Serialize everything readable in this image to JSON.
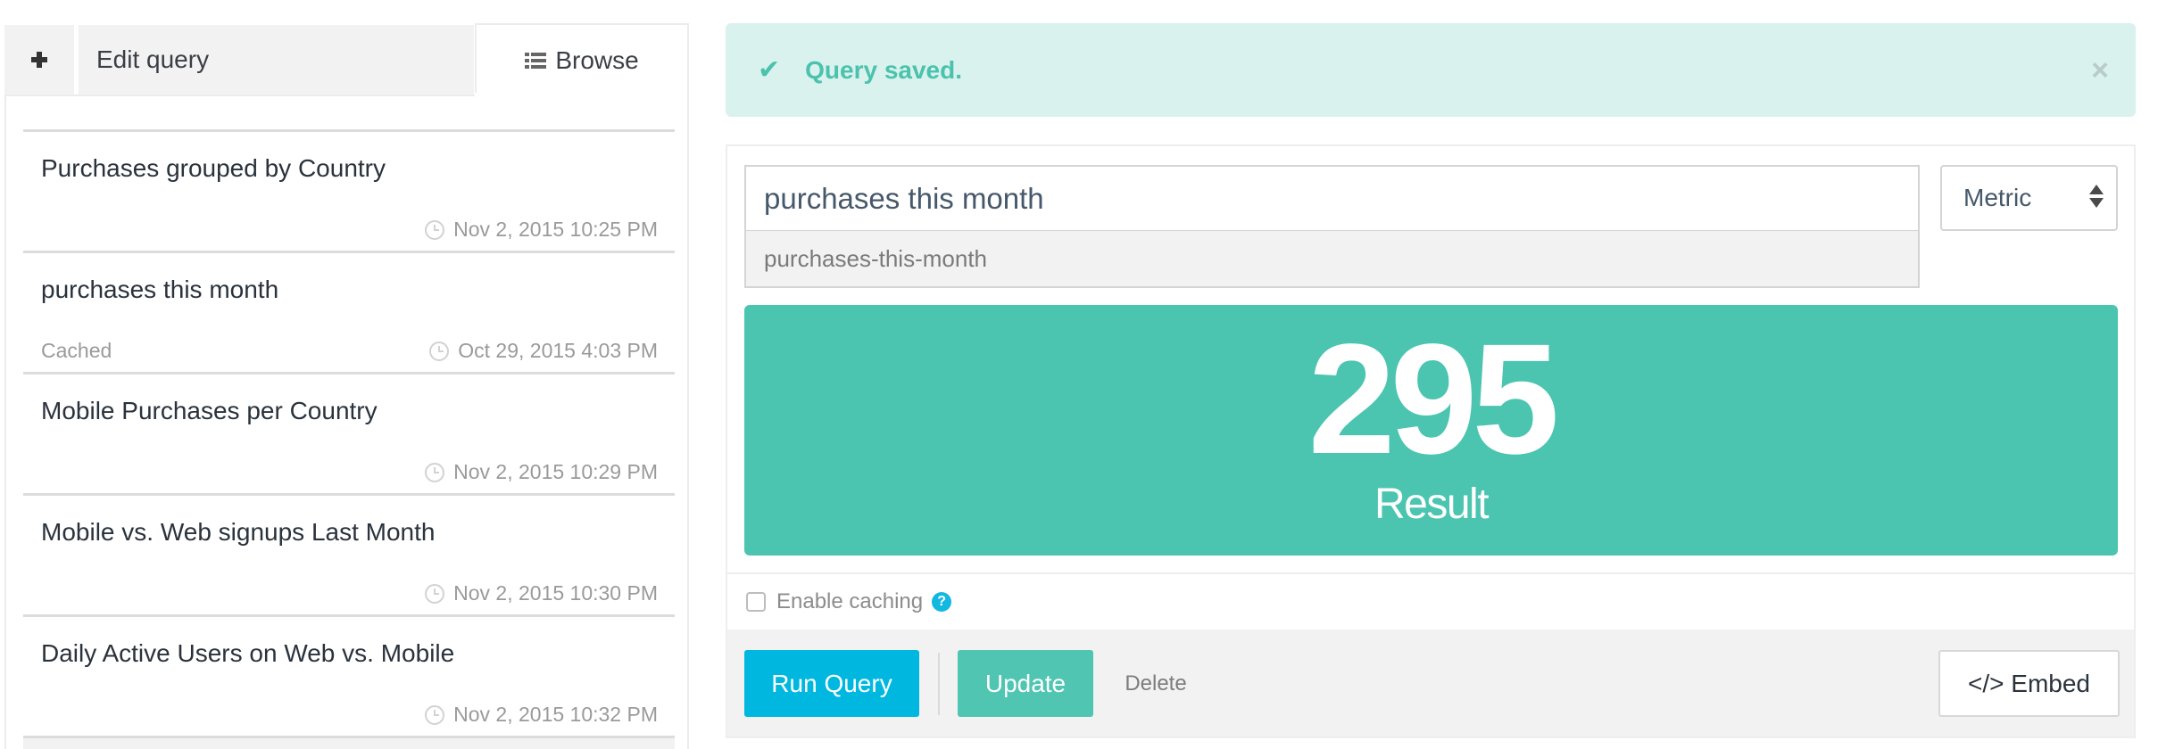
{
  "tabs": {
    "new_icon": "plus-icon",
    "new_label": "+",
    "edit_label": "Edit query",
    "browse_icon": "list-icon",
    "browse_label": "Browse",
    "active": "Browse"
  },
  "saved_queries": [
    {
      "title": "Purchases grouped by Country",
      "cached": "",
      "date": "Nov 2, 2015 10:25 PM"
    },
    {
      "title": "purchases this month",
      "cached": "Cached",
      "date": "Oct 29, 2015 4:03 PM"
    },
    {
      "title": "Mobile Purchases per Country",
      "cached": "",
      "date": "Nov 2, 2015 10:29 PM"
    },
    {
      "title": "Mobile vs. Web signups Last Month",
      "cached": "",
      "date": "Nov 2, 2015 10:30 PM"
    },
    {
      "title": "Daily Active Users on Web vs. Mobile",
      "cached": "",
      "date": "Nov 2, 2015 10:32 PM"
    }
  ],
  "alert": {
    "icon": "check-icon",
    "message": "Query saved.",
    "close_label": "×",
    "color": "#4bc2ad",
    "background": "#d9f2ed"
  },
  "query": {
    "name": "purchases this month",
    "slug": "purchases-this-month",
    "visualization": "Metric"
  },
  "result": {
    "value": "295",
    "label": "Result",
    "color": "#4bc5b0"
  },
  "caching": {
    "label": "Enable caching",
    "checked": false,
    "help_label": "?"
  },
  "actions": {
    "run_label": "Run Query",
    "update_label": "Update",
    "delete_label": "Delete",
    "embed_label": "</> Embed",
    "run_color": "#00b8df",
    "update_color": "#4fc5b2"
  }
}
